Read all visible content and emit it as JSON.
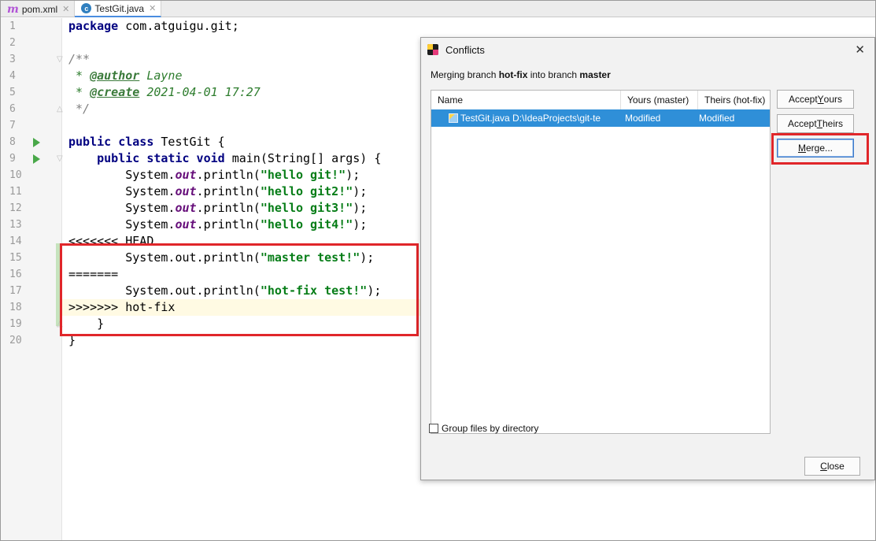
{
  "tabs": [
    {
      "label": "pom.xml",
      "icon": "maven-icon"
    },
    {
      "label": "TestGit.java",
      "icon": "java-class-icon"
    }
  ],
  "editor": {
    "line_numbers": [
      "1",
      "2",
      "3",
      "4",
      "5",
      "6",
      "7",
      "8",
      "9",
      "10",
      "11",
      "12",
      "13",
      "14",
      "15",
      "16",
      "17",
      "18",
      "19",
      "20"
    ],
    "lines": {
      "l1_kw": "package",
      "l1_rest": " com.atguigu.git;",
      "l3": "/**",
      "l4_pre": " * ",
      "l4_tag": "@author",
      "l4_val": " Layne",
      "l5_pre": " * ",
      "l5_tag": "@create",
      "l5_val": " 2021-04-01 17:27",
      "l6": " */",
      "l7_kw": "public class",
      "l7_rest": " TestGit {",
      "l8_ind": "    ",
      "l8_kw": "public static void",
      "l8_rest": " main(String[] args) {",
      "sys_prefix": "        System.",
      "out": "out",
      "println_open": ".println(",
      "println_close": ");",
      "s9": "\"hello git!\"",
      "s10": "\"hello git2!\"",
      "s11": "\"hello git3!\"",
      "s12": "\"hello git4!\"",
      "l13": "<<<<<<< HEAD",
      "l14_pre": "        System.out.println(",
      "l14_str": "\"master test!\"",
      "l14_post": ");",
      "l15": "=======",
      "l16_pre": "        System.out.println(",
      "l16_str": "\"hot-fix test!\"",
      "l16_post": ");",
      "l17": ">>>>>>> hot-fix",
      "l18": "    }",
      "l19": "}"
    }
  },
  "dialog": {
    "title": "Conflicts",
    "close_glyph": "✕",
    "message_pre": "Merging branch ",
    "source_branch": "hot-fix",
    "message_mid": " into branch ",
    "target_branch": "master",
    "columns": [
      "Name",
      "Yours (master)",
      "Theirs (hot-fix)"
    ],
    "rows": [
      {
        "name": "TestGit.java  D:\\IdeaProjects\\git-te",
        "yours": "Modified",
        "theirs": "Modified"
      }
    ],
    "buttons": {
      "accept_yours_pre": "Accept ",
      "accept_yours_mn": "Y",
      "accept_yours_post": "ours",
      "accept_theirs_pre": "Accept ",
      "accept_theirs_mn": "T",
      "accept_theirs_post": "heirs",
      "merge_mn": "M",
      "merge_post": "erge...",
      "close_mn": "C",
      "close_post": "lose"
    },
    "group_files_label": "Group files by directory",
    "group_files_checked": false
  },
  "colors": {
    "highlight_red": "#e0262a",
    "selection_blue": "#2f8fd8",
    "string_green": "#067d17",
    "keyword_navy": "#000080"
  }
}
